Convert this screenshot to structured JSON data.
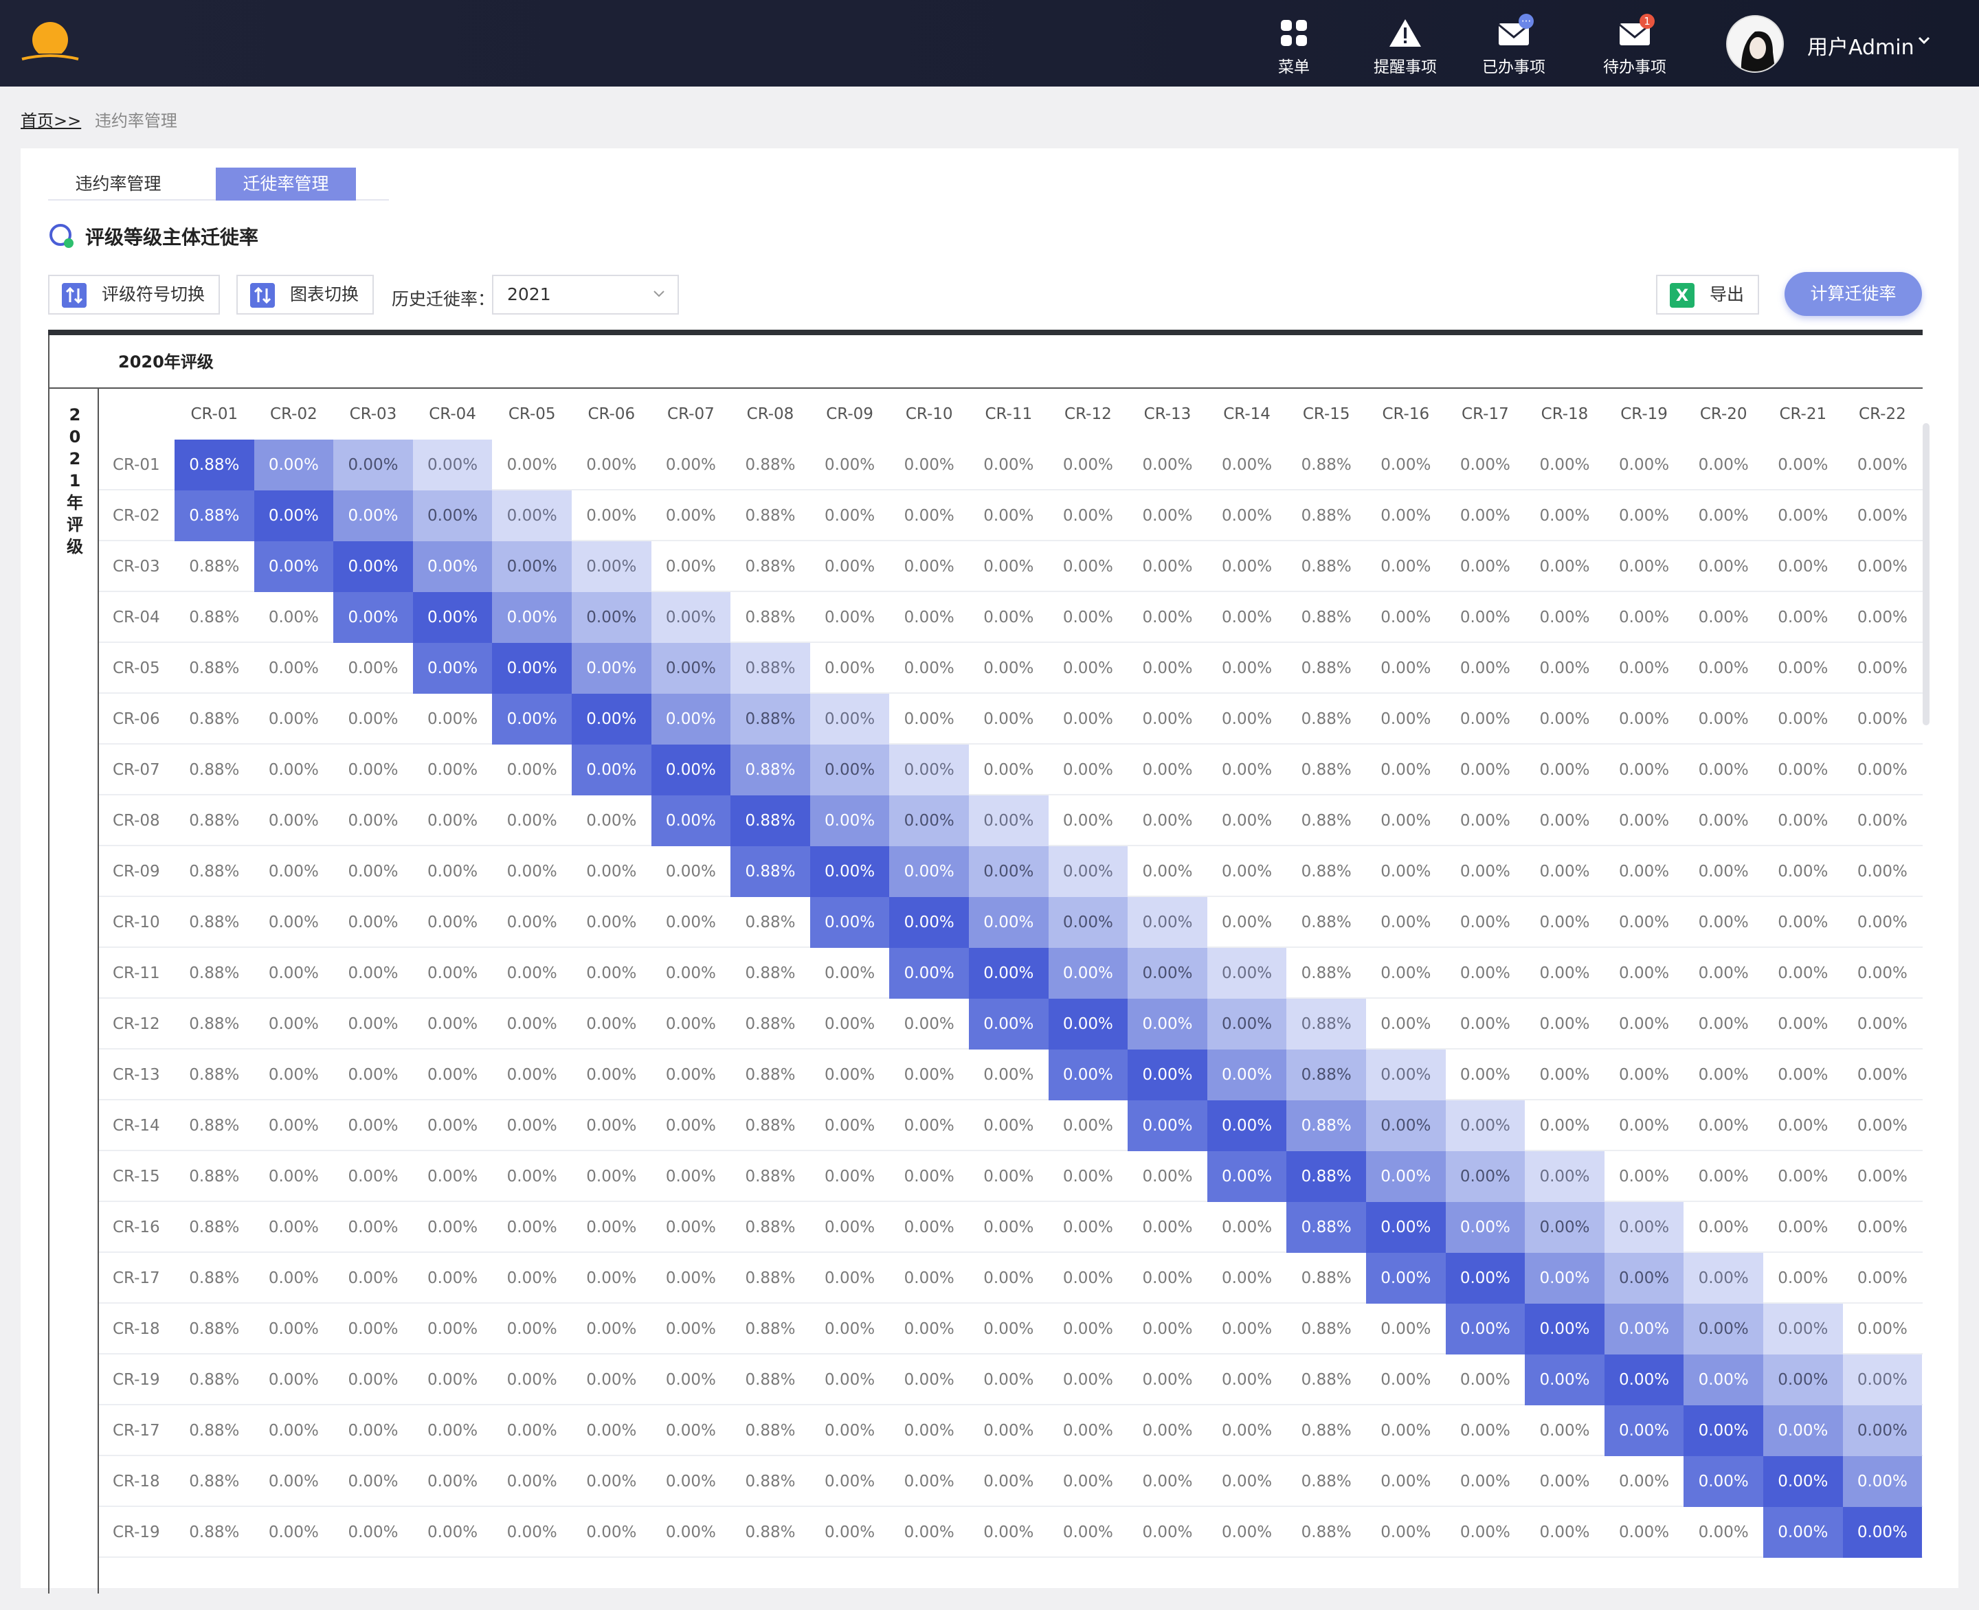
{
  "topbar": {
    "nav": [
      {
        "label": "菜单",
        "icon": "grid-menu-icon",
        "badge": ""
      },
      {
        "label": "提醒事项",
        "icon": "warning-icon",
        "badge": ""
      },
      {
        "label": "已办事项",
        "icon": "mail-done-icon",
        "badge": "···"
      },
      {
        "label": "待办事项",
        "icon": "mail-todo-icon",
        "badge": "1"
      }
    ],
    "user": "用户Admin"
  },
  "breadcrumb": {
    "home": "首页>>",
    "current": "违约率管理"
  },
  "tabs": [
    {
      "label": "违约率管理",
      "active": false
    },
    {
      "label": "迁徙率管理",
      "active": true
    }
  ],
  "section_title": "评级等级主体迁徙率",
  "toolbar": {
    "switch_rating": "评级符号切换",
    "switch_chart": "图表切换",
    "history_label": "历史迁徙率：",
    "year_value": "2021",
    "export": "导出",
    "export_icon_glyph": "X",
    "calc": "计算迁徙率"
  },
  "colors": {
    "accent": "#7d8ce4",
    "heat": [
      "#4a5ed6",
      "#6275dc",
      "#8897e3",
      "#b0bbed",
      "#d4daf6"
    ]
  },
  "matrix": {
    "column_axis_label": "2020年评级",
    "row_axis_label": [
      "2",
      "0",
      "2",
      "1",
      "年",
      "评",
      "级"
    ],
    "columns": [
      "CR-01",
      "CR-02",
      "CR-03",
      "CR-04",
      "CR-05",
      "CR-06",
      "CR-07",
      "CR-08",
      "CR-09",
      "CR-10",
      "CR-11",
      "CR-12",
      "CR-13",
      "CR-14",
      "CR-15",
      "CR-16",
      "CR-17",
      "CR-18",
      "CR-19",
      "CR-20",
      "CR-21",
      "CR-22"
    ],
    "rows": [
      "CR-01",
      "CR-02",
      "CR-03",
      "CR-04",
      "CR-05",
      "CR-06",
      "CR-07",
      "CR-08",
      "CR-09",
      "CR-10",
      "CR-11",
      "CR-12",
      "CR-13",
      "CR-14",
      "CR-15",
      "CR-16",
      "CR-17",
      "CR-18",
      "CR-19",
      "CR-17",
      "CR-18",
      "CR-19"
    ],
    "highlight_column_values": {
      "CR-01": "0.88%",
      "CR-08": "0.88%",
      "CR-15": "0.88%"
    },
    "default_value": "0.00%"
  }
}
